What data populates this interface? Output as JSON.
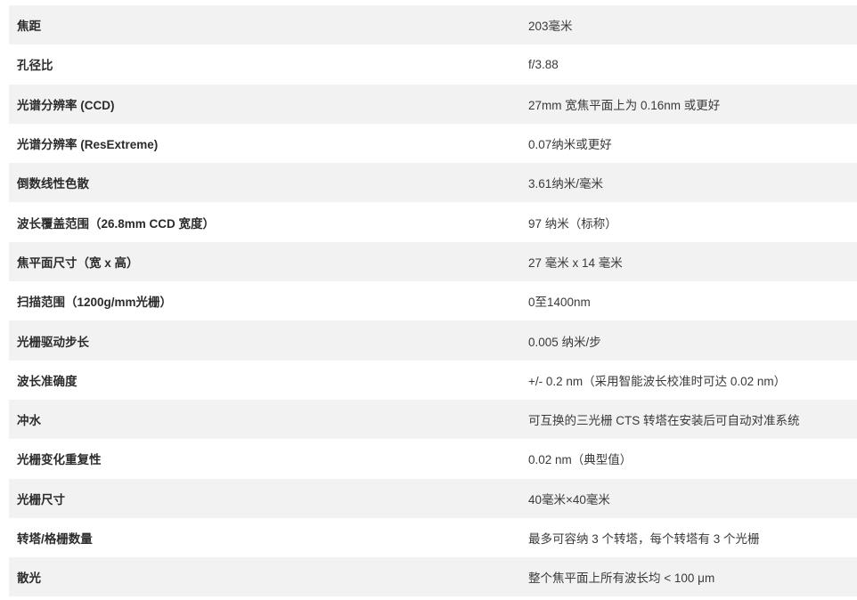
{
  "specs": [
    {
      "label": "焦距",
      "value": "203毫米"
    },
    {
      "label": "孔径比",
      "value": "f/3.88"
    },
    {
      "label": "光谱分辨率 (CCD)",
      "value": "27mm 宽焦平面上为 0.16nm 或更好"
    },
    {
      "label": "光谱分辨率 (ResExtreme)",
      "value": "0.07纳米或更好"
    },
    {
      "label": "倒数线性色散",
      "value": "3.61纳米/毫米"
    },
    {
      "label": "波长覆盖范围（26.8mm CCD 宽度）",
      "value": "97 纳米（标称）"
    },
    {
      "label": "焦平面尺寸（宽 x 高）",
      "value": "27 毫米 x 14 毫米"
    },
    {
      "label": "扫描范围（1200g/mm光栅）",
      "value": "0至1400nm"
    },
    {
      "label": "光栅驱动步长",
      "value": "0.005 纳米/步"
    },
    {
      "label": "波长准确度",
      "value": "+/- 0.2 nm（采用智能波长校准时可达 0.02 nm）"
    },
    {
      "label": "冲水",
      "value": "可互换的三光栅 CTS 转塔在安装后可自动对准系统"
    },
    {
      "label": "光栅变化重复性",
      "value": "0.02 nm（典型值）"
    },
    {
      "label": "光栅尺寸",
      "value": "40毫米×40毫米"
    },
    {
      "label": "转塔/格栅数量",
      "value": "最多可容纳 3 个转塔，每个转塔有 3 个光栅"
    },
    {
      "label": "散光",
      "value": "整个焦平面上所有波长均 < 100 μm"
    }
  ]
}
